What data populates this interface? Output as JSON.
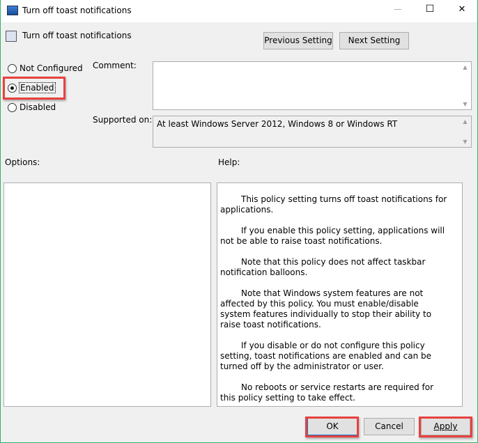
{
  "window": {
    "title": "Turn off toast notifications",
    "minimize": "—",
    "maximize": "☐",
    "close": "✕"
  },
  "header": {
    "policy_name": "Turn off toast notifications",
    "previous_label": "Previous Setting",
    "next_label": "Next Setting"
  },
  "state": {
    "options": [
      {
        "label": "Not Configured",
        "selected": false
      },
      {
        "label": "Enabled",
        "selected": true
      },
      {
        "label": "Disabled",
        "selected": false
      }
    ]
  },
  "comment": {
    "label": "Comment:",
    "value": ""
  },
  "supported": {
    "label": "Supported on:",
    "value": "At least Windows Server 2012, Windows 8 or Windows RT"
  },
  "options_label": "Options:",
  "help": {
    "label": "Help:",
    "paragraphs": [
      "This policy setting turns off toast notifications for applications.",
      "If you enable this policy setting, applications will not be able to raise toast notifications.",
      "Note that this policy does not affect taskbar notification balloons.",
      "Note that Windows system features are not affected by this policy.  You must enable/disable system features individually to stop their ability to raise toast notifications.",
      "If you disable or do not configure this policy setting, toast notifications are enabled and can be turned off by the administrator or user.",
      "No reboots or service restarts are required for this policy setting to take effect."
    ]
  },
  "footer": {
    "ok": "OK",
    "cancel": "Cancel",
    "apply": "Apply"
  },
  "colors": {
    "highlight": "#e8413e",
    "border": "#2fb36a"
  }
}
